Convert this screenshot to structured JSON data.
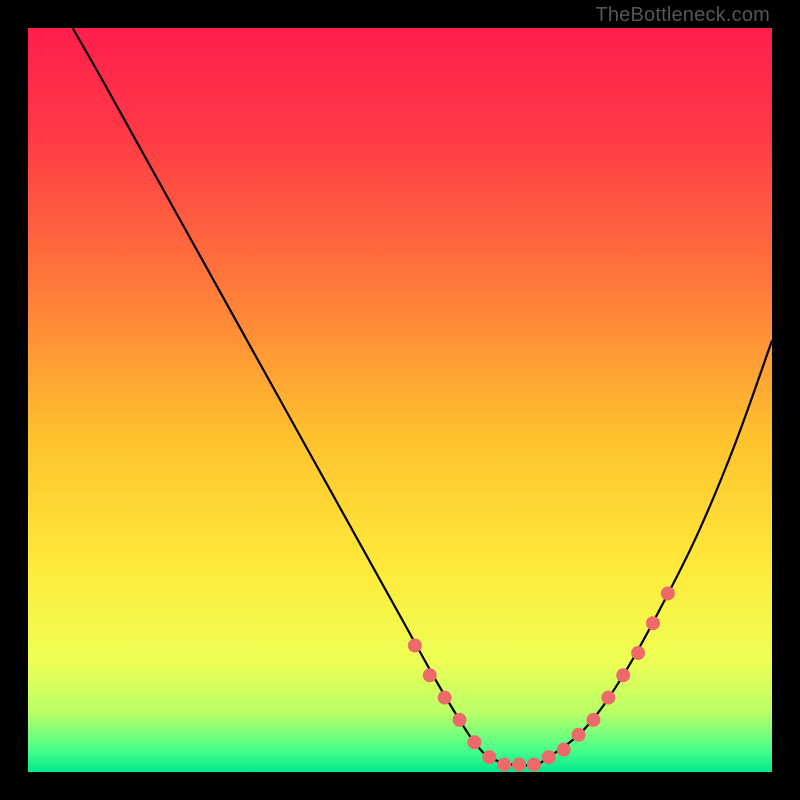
{
  "watermark": "TheBottleneck.com",
  "chart_data": {
    "type": "line",
    "title": "",
    "xlabel": "",
    "ylabel": "",
    "xlim": [
      0,
      100
    ],
    "ylim": [
      0,
      100
    ],
    "grid": false,
    "legend": false,
    "series": [
      {
        "name": "curve",
        "color": "#000000",
        "x": [
          6,
          10,
          15,
          20,
          25,
          30,
          35,
          40,
          45,
          50,
          55,
          58,
          60,
          62,
          65,
          68,
          70,
          75,
          80,
          85,
          90,
          95,
          100
        ],
        "y": [
          100,
          93,
          84,
          75,
          66,
          57,
          48,
          39,
          30,
          21,
          12,
          7,
          4,
          2,
          1,
          1,
          2,
          6,
          13,
          22,
          32,
          44,
          58
        ]
      },
      {
        "name": "markers",
        "type": "scatter",
        "color": "#ED6A6A",
        "x": [
          52,
          54,
          56,
          58,
          60,
          62,
          64,
          66,
          68,
          70,
          72,
          74,
          76,
          78,
          80,
          82,
          84,
          86
        ],
        "y": [
          17,
          13,
          10,
          7,
          4,
          2,
          1,
          1,
          1,
          2,
          3,
          5,
          7,
          10,
          13,
          16,
          20,
          24
        ]
      }
    ],
    "background_gradient": {
      "type": "vertical",
      "stops": [
        {
          "offset": 0.0,
          "color": "#FF1E4C"
        },
        {
          "offset": 0.15,
          "color": "#FF3B46"
        },
        {
          "offset": 0.35,
          "color": "#FF7A3A"
        },
        {
          "offset": 0.55,
          "color": "#FFC22E"
        },
        {
          "offset": 0.72,
          "color": "#FFE93A"
        },
        {
          "offset": 0.85,
          "color": "#EFFF55"
        },
        {
          "offset": 0.92,
          "color": "#B9FF66"
        },
        {
          "offset": 0.97,
          "color": "#4BFF8B"
        },
        {
          "offset": 1.0,
          "color": "#00E88C"
        }
      ]
    }
  }
}
